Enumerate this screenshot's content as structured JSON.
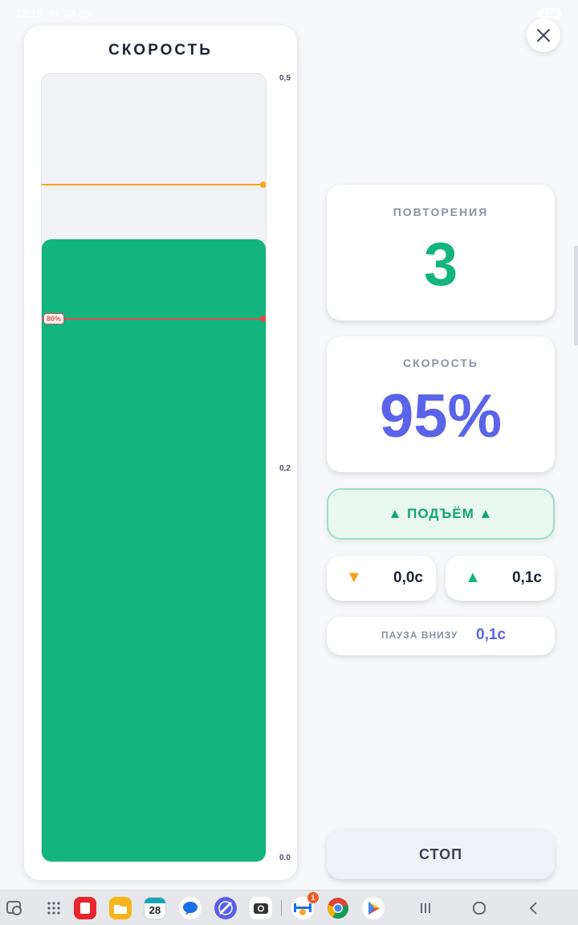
{
  "status_bar": {
    "time": "12:15",
    "date": "пт, 28 авг.",
    "battery": "100"
  },
  "speed_panel": {
    "title": "СКОРОСТЬ",
    "threshold_label": "80%",
    "ticks": [
      "0,5",
      "0,2",
      "0.0"
    ],
    "fill_level": 0.79,
    "colors": {
      "fill": "#12b57d",
      "orange_line": "#f5a623",
      "red_line": "#e84a4a"
    }
  },
  "close_icon": "close-icon",
  "reps": {
    "label": "ПОВТОРЕНИЯ",
    "value": "3"
  },
  "speed": {
    "label": "СКОРОСТЬ",
    "value": "95%"
  },
  "phase": {
    "label": "▲ ПОДЪЁМ ▲"
  },
  "timings": {
    "down": {
      "arrow": "▼",
      "value": "0,0с"
    },
    "up": {
      "arrow": "▲",
      "value": "0,1с"
    }
  },
  "pause": {
    "label": "ПАУЗА ВНИЗУ",
    "value": "0,1с"
  },
  "stop_button": {
    "label": "СТОП"
  },
  "navbar": {
    "calendar_day": "28",
    "badge_count": "1",
    "apps": [
      "recent-apps-icon",
      "apps-grid-icon",
      "notes-app-icon",
      "files-app-icon",
      "calendar-app-icon",
      "messages-app-icon",
      "browser-app-icon",
      "camera-app-icon",
      "workout-app-icon",
      "chrome-app-icon",
      "play-store-app-icon"
    ],
    "system": [
      "recents-nav-icon",
      "home-nav-icon",
      "back-nav-icon"
    ]
  }
}
